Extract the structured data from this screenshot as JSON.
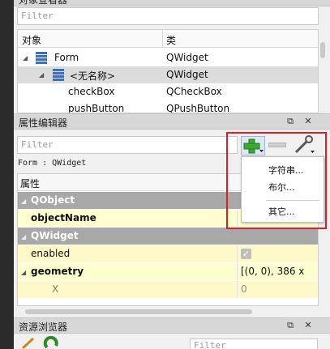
{
  "object_inspector": {
    "title": "对象查看器",
    "filter_placeholder": "Filter",
    "columns": [
      "对象",
      "类"
    ],
    "rows": [
      {
        "object": "Form",
        "class": "QWidget"
      },
      {
        "object": "<无名称>",
        "class": "QWidget"
      },
      {
        "object": "checkBox",
        "class": "QCheckBox"
      },
      {
        "object": "pushButton",
        "class": "QPushButton"
      }
    ]
  },
  "property_editor": {
    "title": "属性编辑器",
    "filter_placeholder": "Filter",
    "object_path": "Form : QWidget",
    "header": "属性",
    "rows": [
      {
        "name": "QObject",
        "value": "",
        "kind": "category"
      },
      {
        "name": "objectName",
        "value": "",
        "kind": "bold"
      },
      {
        "name": "QWidget",
        "value": "",
        "kind": "category"
      },
      {
        "name": "enabled",
        "value": "",
        "kind": "checkbox",
        "checked": true
      },
      {
        "name": "geometry",
        "value": "[(0, 0), 386 x",
        "kind": "bold"
      },
      {
        "name": "X",
        "value": "0",
        "kind": "sub"
      }
    ],
    "add_menu": [
      "字符串...",
      "布尔...",
      "其它..."
    ]
  },
  "resource_browser": {
    "title": "资源浏览器",
    "filter_placeholder": "Filter"
  },
  "colors": {
    "category_bg": "#a8a8a8",
    "highlight_border": "#e01e28",
    "plus_green": "#3aa832"
  }
}
